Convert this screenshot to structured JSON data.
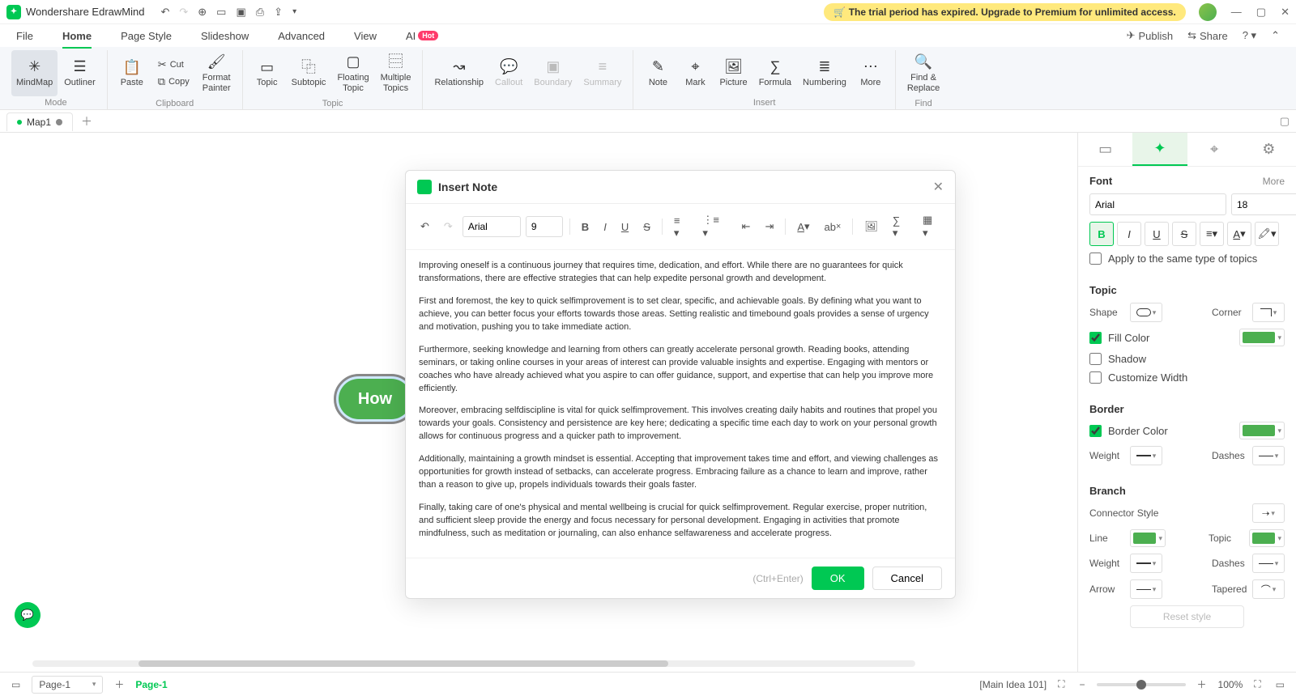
{
  "titlebar": {
    "app_name": "Wondershare EdrawMind",
    "trial_banner": "The trial period has expired. Upgrade to Premium for unlimited access."
  },
  "menutabs": {
    "file": "File",
    "home": "Home",
    "page_style": "Page Style",
    "slideshow": "Slideshow",
    "advanced": "Advanced",
    "view": "View",
    "ai": "AI",
    "hot": "Hot",
    "publish": "Publish",
    "share": "Share"
  },
  "ribbon": {
    "mode_label": "Mode",
    "mindmap": "MindMap",
    "outliner": "Outliner",
    "clipboard_label": "Clipboard",
    "paste": "Paste",
    "cut": "Cut",
    "copy": "Copy",
    "format_painter": "Format\nPainter",
    "topic_label": "Topic",
    "topic": "Topic",
    "subtopic": "Subtopic",
    "floating_topic": "Floating\nTopic",
    "multiple_topics": "Multiple\nTopics",
    "relationship": "Relationship",
    "callout": "Callout",
    "boundary": "Boundary",
    "summary": "Summary",
    "insert_label": "Insert",
    "note": "Note",
    "mark": "Mark",
    "picture": "Picture",
    "formula": "Formula",
    "numbering": "Numbering",
    "more": "More",
    "find_label": "Find",
    "find_replace": "Find &\nReplace"
  },
  "doctabs": {
    "map1": "Map1"
  },
  "canvas": {
    "central_text": "How"
  },
  "modal": {
    "title": "Insert Note",
    "font": "Arial",
    "size": "9",
    "hint": "(Ctrl+Enter)",
    "ok": "OK",
    "cancel": "Cancel",
    "paragraphs": [
      "Improving oneself is a continuous journey that requires time, dedication, and effort. While there are no guarantees for quick transformations, there are effective strategies that can help expedite personal growth and development.",
      "First and foremost, the key to quick selfimprovement is to set clear, specific, and achievable goals. By defining what you want to achieve, you can better focus your efforts towards those areas. Setting realistic and timebound goals provides a sense of urgency and motivation, pushing you to take immediate action.",
      "Furthermore, seeking knowledge and learning from others can greatly accelerate personal growth. Reading books, attending seminars, or taking online courses in your areas of interest can provide valuable insights and expertise. Engaging with mentors or coaches who have already achieved what you aspire to can offer guidance, support, and expertise that can help you improve more efficiently.",
      "Moreover, embracing selfdiscipline is vital for quick selfimprovement. This involves creating daily habits and routines that propel you towards your goals. Consistency and persistence are key here; dedicating a specific time each day to work on your personal growth allows for continuous progress and a quicker path to improvement.",
      "Additionally, maintaining a growth mindset is essential. Accepting that improvement takes time and effort, and viewing challenges as opportunities for growth instead of setbacks, can accelerate progress. Embracing failure as a chance to learn and improve, rather than a reason to give up, propels individuals towards their goals faster.",
      "Finally, taking care of one's physical and mental wellbeing is crucial for quick selfimprovement. Regular exercise, proper nutrition, and sufficient sleep provide the energy and focus necessary for personal development. Engaging in activities that promote mindfulness, such as meditation or journaling, can also enhance selfawareness and accelerate progress."
    ]
  },
  "rightpanel": {
    "font_title": "Font",
    "more": "More",
    "font_family": "Arial",
    "font_size": "18",
    "apply_same": "Apply to the same type of topics",
    "topic_title": "Topic",
    "shape_label": "Shape",
    "corner_label": "Corner",
    "fill_color": "Fill Color",
    "shadow": "Shadow",
    "customize_width": "Customize Width",
    "border_title": "Border",
    "border_color": "Border Color",
    "weight_label": "Weight",
    "dashes_label": "Dashes",
    "branch_title": "Branch",
    "connector_style": "Connector Style",
    "line_label": "Line",
    "topic_color_label": "Topic",
    "arrow_label": "Arrow",
    "tapered_label": "Tapered",
    "reset_style": "Reset style"
  },
  "statusbar": {
    "page_selector": "Page-1",
    "page_active": "Page-1",
    "status_text": "[Main Idea 101]",
    "zoom": "100%"
  },
  "colors": {
    "accent": "#00c853",
    "fill": "#4caf50",
    "border": "#4caf50"
  }
}
